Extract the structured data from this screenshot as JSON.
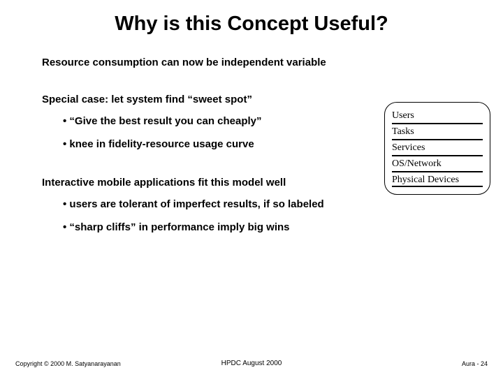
{
  "title": "Why is this Concept Useful?",
  "body": {
    "p1": "Resource consumption can now be independent variable",
    "p2": "Special case: let system find “sweet spot”",
    "b1a": "“Give the best result you can cheaply”",
    "b1b": "knee in fidelity-resource usage curve",
    "p3": "Interactive mobile applications fit this model well",
    "b2a": "users are tolerant of imperfect results, if so labeled",
    "b2b": "“sharp cliffs” in performance imply big wins"
  },
  "stack": {
    "r1": "Users",
    "r2": "Tasks",
    "r3": "Services",
    "r4": "OS/Network",
    "r5": "Physical Devices"
  },
  "footer": {
    "left": "Copyright © 2000 M. Satyanarayanan",
    "mid": "HPDC August  2000",
    "right": "Aura - 24"
  }
}
